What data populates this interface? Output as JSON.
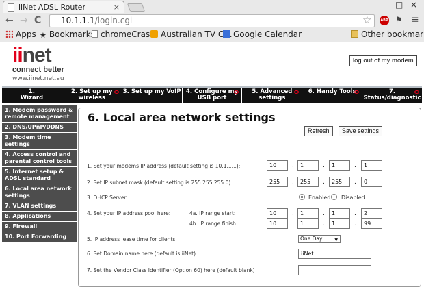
{
  "browser": {
    "tab_title": "iiNet ADSL Router",
    "tab_close": "×",
    "window_min": "–",
    "window_max": "□",
    "window_close": "×",
    "back": "←",
    "forward": "→",
    "reload": "C",
    "address_host": "10.1.1.1",
    "address_path": "/login.cgi",
    "star": "☆",
    "abp_badge": "ABP",
    "menu": "≡"
  },
  "bookmarks": {
    "apps": "Apps",
    "bookmarks": "Bookmarks",
    "items": [
      "chromeCrash",
      "Australian TV G...",
      "Google Calendar"
    ],
    "other": "Other bookmarks"
  },
  "header": {
    "logo_i": "ii",
    "logo_rest": "net",
    "tagline": "connect better",
    "url": "www.iinet.net.au",
    "logout": "log out of my modem"
  },
  "topnav": [
    {
      "label": "1.\nWizard"
    },
    {
      "label": "2. Set up my\nwireless"
    },
    {
      "label": "3. Set up my VoIP"
    },
    {
      "label": "4. Configure my\nUSB port"
    },
    {
      "label": "5. Advanced\nsettings"
    },
    {
      "label": "6. Handy Tools"
    },
    {
      "label": "7. Status/diagnostic"
    }
  ],
  "sidebar": [
    "1. Modem password & remote management",
    "2. DNS/UPnP/DDNS",
    "3. Modem time settings",
    "4. Access control and parental control tools",
    "5. Internet setup & ADSL standard",
    "6. Local area network settings",
    "7. VLAN settings",
    "8. Applications",
    "9. Firewall",
    "10. Port Forwarding"
  ],
  "main": {
    "title": "6. Local area network settings",
    "refresh": "Refresh",
    "save": "Save settings",
    "row1": "1. Set your modems IP address (default setting is 10.1.1.1):",
    "ip": [
      "10",
      "1",
      "1",
      "1"
    ],
    "row2": "2. Set IP subnet mask (default setting is 255.255.255.0):",
    "mask": [
      "255",
      "255",
      "255",
      "0"
    ],
    "row3": "3. DHCP Server",
    "enabled": "Enabled",
    "disabled": "Disabled",
    "row4": "4. Set your IP address pool here:",
    "row4a": "4a. IP range start:",
    "start": [
      "10",
      "1",
      "1",
      "2"
    ],
    "row4b": "4b. IP range finish:",
    "finish": [
      "10",
      "1",
      "1",
      "99"
    ],
    "row5": "5. IP address lease time for clients",
    "lease": "One Day",
    "row6": "6. Set Domain name here (default is iiNet)",
    "domain": "iiNet",
    "row7": "7. Set the Vendor Class Identifier (Option 60) here (default blank)",
    "vendor": ""
  }
}
